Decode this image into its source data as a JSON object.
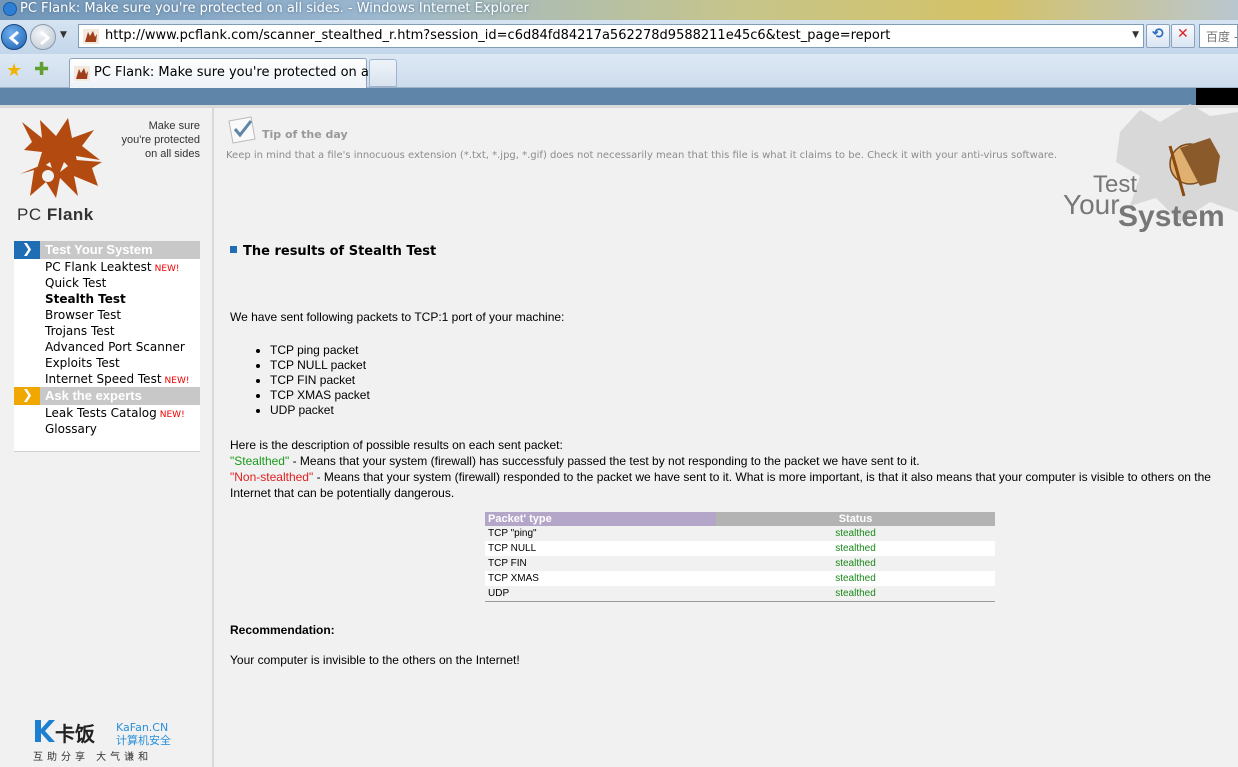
{
  "window": {
    "title": "PC Flank: Make sure you're protected on all sides. - Windows Internet Explorer"
  },
  "address_bar": {
    "url": "http://www.pcflank.com/scanner_stealthed_r.htm?session_id=c6d84fd84217a562278d9588211e45c6&test_page=report"
  },
  "search_box": {
    "placeholder": "百度 -"
  },
  "tabs": [
    {
      "label": "PC Flank: Make sure you're protected on all ..."
    }
  ],
  "logo": {
    "name_light": "PC ",
    "name_bold": "Flank",
    "tagline": [
      "Make sure",
      "you're protected",
      "on all sides"
    ]
  },
  "sidebar": {
    "sections": [
      {
        "header": "Test Your System",
        "color": "blue",
        "items": [
          {
            "label": "PC Flank Leaktest",
            "badge": "NEW!"
          },
          {
            "label": "Quick Test",
            "badge": ""
          },
          {
            "label": "Stealth Test",
            "badge": "",
            "active": true
          },
          {
            "label": "Browser Test",
            "badge": ""
          },
          {
            "label": "Trojans Test",
            "badge": ""
          },
          {
            "label": "Advanced Port Scanner",
            "badge": ""
          },
          {
            "label": "Exploits Test",
            "badge": ""
          },
          {
            "label": "Internet Speed Test",
            "badge": "NEW!"
          }
        ]
      },
      {
        "header": "Ask the experts",
        "color": "orange",
        "items": [
          {
            "label": "Leak Tests Catalog",
            "badge": "NEW!"
          },
          {
            "label": "Glossary",
            "badge": ""
          }
        ]
      }
    ]
  },
  "tip": {
    "title": "Tip of the day",
    "text": "Keep in mind that a file's innocuous extension (*.txt, *.jpg, *.gif) does not necessarily mean that this file is what it claims to be. Check it with your anti-virus software."
  },
  "brand_logo": {
    "line1": "Test",
    "line2": "Your",
    "line3": "System"
  },
  "main": {
    "title": "The results of Stealth Test",
    "intro": "We have sent following packets to TCP:1 port of your machine:",
    "packets": [
      "TCP ping packet",
      "TCP NULL packet",
      "TCP FIN packet",
      "TCP XMAS packet",
      "UDP packet"
    ],
    "desc_intro": "Here is the description of possible results on each sent packet:",
    "stealthed_term": "\"Stealthed\"",
    "stealthed_desc": " - Means that your system (firewall) has successfuly passed the test by not responding to the packet we have sent to it.",
    "nonstealthed_term": "\"Non-stealthed\"",
    "nonstealthed_desc": " - Means that your system (firewall) responded to the packet we have sent to it. What is more important, is that it also means that your computer is visible to others on the Internet that can be potentially dangerous.",
    "table": {
      "headers": [
        "Packet' type",
        "Status"
      ],
      "rows": [
        {
          "type": "TCP \"ping\"",
          "status": "stealthed"
        },
        {
          "type": "TCP NULL",
          "status": "stealthed"
        },
        {
          "type": "TCP FIN",
          "status": "stealthed"
        },
        {
          "type": "TCP XMAS",
          "status": "stealthed"
        },
        {
          "type": "UDP",
          "status": "stealthed"
        }
      ]
    },
    "recommendation_title": "Recommendation:",
    "recommendation_text": "Your computer is invisible to the others on the Internet!"
  },
  "watermark": {
    "name": "卡饭",
    "site": "KaFan.CN",
    "site_sub": "计算机安全",
    "slogan": "互助分享 大气谦和"
  },
  "colors": {
    "accent_blue": "#1e6db5",
    "accent_orange": "#f0a800",
    "stealthed_green": "#1a9a1a",
    "nonstealthed_red": "#e02020"
  }
}
